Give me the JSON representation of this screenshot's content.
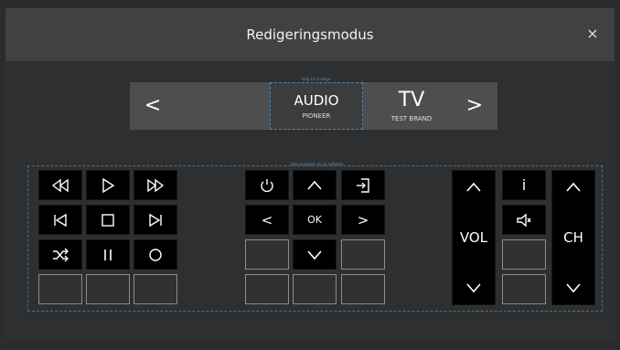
{
  "header": {
    "title": "Redigeringsmodus",
    "close_glyph": "×"
  },
  "carousel": {
    "hint": "Velg for å velge",
    "prev_glyph": "<",
    "next_glyph": ">",
    "devices": [
      {
        "name": "AUDIO",
        "brand": "PIONEER",
        "selected": true
      },
      {
        "name": "TV",
        "brand": "TEST BRAND",
        "selected": false
      }
    ]
  },
  "keypad": {
    "hint": "Velg knappen du vil redigere",
    "media": {
      "rewind": "rewind-icon",
      "play": "play-icon",
      "fast_forward": "fast-forward-icon",
      "skip_back": "skip-back-icon",
      "stop": "stop-icon",
      "skip_forward": "skip-forward-icon",
      "shuffle": "shuffle-icon",
      "pause": "pause-icon",
      "record": "record-icon"
    },
    "nav": {
      "ok_label": "OK",
      "left_glyph": "<",
      "right_glyph": ">"
    },
    "volume": {
      "label": "VOL"
    },
    "channel": {
      "label": "CH"
    },
    "info_glyph": "i"
  }
}
